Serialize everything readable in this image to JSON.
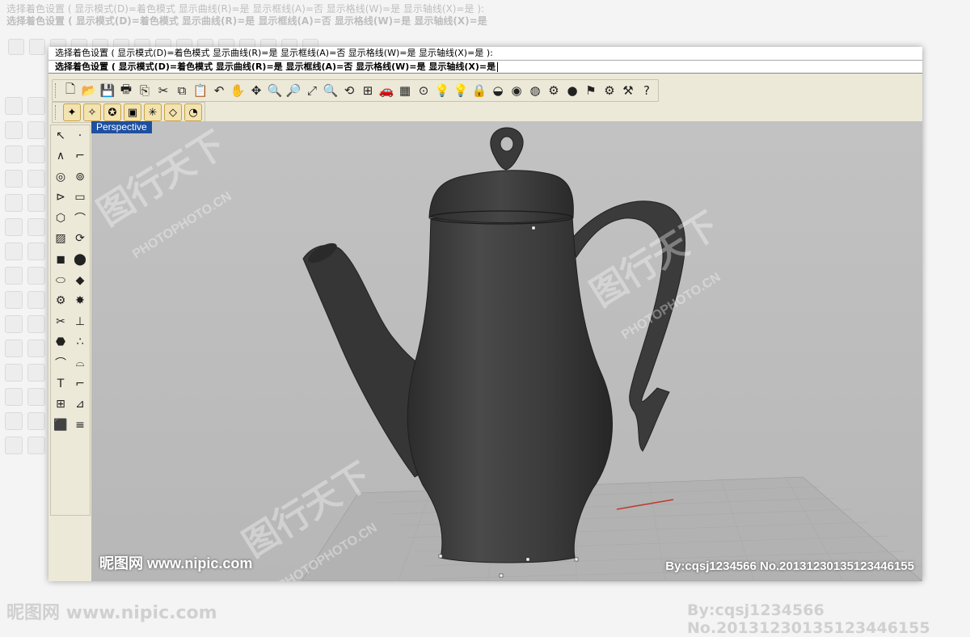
{
  "command": {
    "history": "选择着色设置 ( 显示模式(D)=着色模式  显示曲线(R)=是  显示框线(A)=否  显示格线(W)=是  显示轴线(X)=是 ):",
    "prompt": "选择着色设置 ( 显示模式(D)=着色模式  显示曲线(R)=是  显示框线(A)=否  显示格线(W)=是  显示轴线(X)=是"
  },
  "toolbar": {
    "icons": [
      {
        "name": "new-icon",
        "glyph": "🗋"
      },
      {
        "name": "open-icon",
        "glyph": "📂"
      },
      {
        "name": "save-icon",
        "glyph": "💾"
      },
      {
        "name": "print-icon",
        "glyph": "🖶"
      },
      {
        "name": "import-icon",
        "glyph": "⎘"
      },
      {
        "name": "cut-icon",
        "glyph": "✂"
      },
      {
        "name": "copy-icon",
        "glyph": "⧉"
      },
      {
        "name": "paste-icon",
        "glyph": "📋"
      },
      {
        "name": "undo-icon",
        "glyph": "↶"
      },
      {
        "name": "pan-hand-icon",
        "glyph": "✋"
      },
      {
        "name": "move-view-icon",
        "glyph": "✥"
      },
      {
        "name": "zoom-icon",
        "glyph": "🔍"
      },
      {
        "name": "zoom-window-icon",
        "glyph": "🔎"
      },
      {
        "name": "zoom-extents-icon",
        "glyph": "⤢"
      },
      {
        "name": "zoom-selected-icon",
        "glyph": "🔍"
      },
      {
        "name": "undo-view-icon",
        "glyph": "⟲"
      },
      {
        "name": "four-viewports-icon",
        "glyph": "⊞"
      },
      {
        "name": "car-icon",
        "glyph": "🚗"
      },
      {
        "name": "grid-icon",
        "glyph": "▦"
      },
      {
        "name": "snap-icon",
        "glyph": "⊙"
      },
      {
        "name": "lights-icon",
        "glyph": "💡"
      },
      {
        "name": "lightbulb-icon",
        "glyph": "💡"
      },
      {
        "name": "lock-icon",
        "glyph": "🔒"
      },
      {
        "name": "material-icon",
        "glyph": "◒"
      },
      {
        "name": "color-wheel-icon",
        "glyph": "◉"
      },
      {
        "name": "sphere-wire-icon",
        "glyph": "◍"
      },
      {
        "name": "render-preview-icon",
        "glyph": "⚙"
      },
      {
        "name": "render-sphere-icon",
        "glyph": "●"
      },
      {
        "name": "flag-icon",
        "glyph": "⚑"
      },
      {
        "name": "gears-icon",
        "glyph": "⚙"
      },
      {
        "name": "tools-icon",
        "glyph": "⚒"
      },
      {
        "name": "help-icon",
        "glyph": "?"
      }
    ]
  },
  "toolbar2": {
    "icons": [
      {
        "name": "osnap-end-icon",
        "glyph": "✦"
      },
      {
        "name": "osnap-near-icon",
        "glyph": "✧"
      },
      {
        "name": "osnap-point-icon",
        "glyph": "✪"
      },
      {
        "name": "osnap-cube-icon",
        "glyph": "▣"
      },
      {
        "name": "osnap-star-icon",
        "glyph": "✳"
      },
      {
        "name": "osnap-tan-icon",
        "glyph": "◇"
      },
      {
        "name": "osnap-clock-icon",
        "glyph": "◔"
      }
    ]
  },
  "sidebar": {
    "icons": [
      {
        "name": "select-arrow-icon",
        "glyph": "↖"
      },
      {
        "name": "point-icon",
        "glyph": "·"
      },
      {
        "name": "polyline-icon",
        "glyph": "∧"
      },
      {
        "name": "control-point-icon",
        "glyph": "⌐"
      },
      {
        "name": "circle-icon",
        "glyph": "◎"
      },
      {
        "name": "circle-3pt-icon",
        "glyph": "⊚"
      },
      {
        "name": "curve-icon",
        "glyph": "⊳"
      },
      {
        "name": "rectangle-icon",
        "glyph": "▭"
      },
      {
        "name": "polygon-icon",
        "glyph": "⬡"
      },
      {
        "name": "fillet-curve-icon",
        "glyph": "⌒"
      },
      {
        "name": "surface-icon",
        "glyph": "▨"
      },
      {
        "name": "revolve-icon",
        "glyph": "⟳"
      },
      {
        "name": "box-icon",
        "glyph": "◼"
      },
      {
        "name": "boolean-icon",
        "glyph": "⬤"
      },
      {
        "name": "cylinder-icon",
        "glyph": "⬭"
      },
      {
        "name": "extrude-icon",
        "glyph": "◆"
      },
      {
        "name": "transform-icon",
        "glyph": "⚙"
      },
      {
        "name": "explode-icon",
        "glyph": "✸"
      },
      {
        "name": "trim-icon",
        "glyph": "✂"
      },
      {
        "name": "split-icon",
        "glyph": "⊥"
      },
      {
        "name": "solid-edit-icon",
        "glyph": "⬣"
      },
      {
        "name": "points-group-icon",
        "glyph": "∴"
      },
      {
        "name": "fillet-icon",
        "glyph": "⌒"
      },
      {
        "name": "chamfer-icon",
        "glyph": "⌓"
      },
      {
        "name": "text-icon",
        "glyph": "T"
      },
      {
        "name": "dimension-icon",
        "glyph": "⌐"
      },
      {
        "name": "array-icon",
        "glyph": "⊞"
      },
      {
        "name": "analyze-icon",
        "glyph": "⊿"
      },
      {
        "name": "render-box-icon",
        "glyph": "⬛"
      },
      {
        "name": "hatch-icon",
        "glyph": "≡"
      }
    ]
  },
  "viewport": {
    "label": "Perspective"
  },
  "watermark": {
    "site": "昵图网 www.nipic.com",
    "by": "By:cqsj1234566 No.20131230135123446155",
    "brand": "PHOTOPHOTO.CN",
    "brand_cn": "图行天下"
  },
  "colors": {
    "viewport_bg": "#bdbdbd",
    "teapot": "#3a3a3a",
    "label_bg": "#1e50a0",
    "x_axis": "#c0392b"
  }
}
